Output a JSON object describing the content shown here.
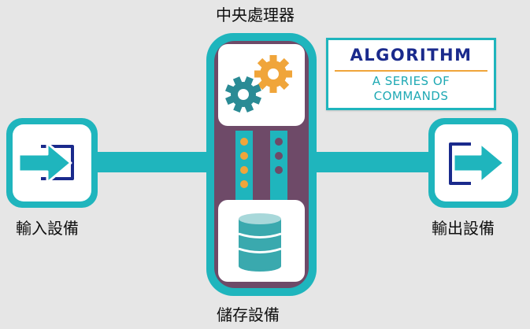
{
  "labels": {
    "cpu": "中央處理器",
    "input": "輸入設備",
    "output": "輸出設備",
    "storage": "儲存設備"
  },
  "algorithm": {
    "title": "ALGORITHM",
    "subtitle_line1": "A SERIES OF",
    "subtitle_line2": "COMMANDS"
  },
  "colors": {
    "background": "#e6e6e6",
    "teal": "#1fb5bd",
    "teal_dark": "#138a92",
    "purple": "#6e4a68",
    "navy": "#1a2a8c",
    "orange": "#f0a53a",
    "gear_teal": "#2a8b95",
    "db_light": "#a8d8da",
    "db_mid": "#3aa9ae"
  },
  "icons": {
    "input": "input-arrow-icon",
    "output": "output-arrow-icon",
    "cpu": "gears-icon",
    "storage": "database-icon"
  }
}
